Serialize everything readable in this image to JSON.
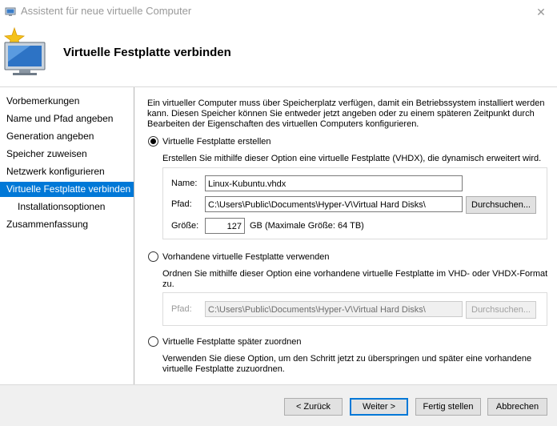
{
  "window": {
    "title": "Assistent für neue virtuelle Computer",
    "close_glyph": "✕"
  },
  "header": {
    "title": "Virtuelle Festplatte verbinden",
    "icon": "new-vm-wizard-icon"
  },
  "sidebar": {
    "items": [
      {
        "label": "Vorbemerkungen",
        "active": false,
        "sub": false
      },
      {
        "label": "Name und Pfad angeben",
        "active": false,
        "sub": false
      },
      {
        "label": "Generation angeben",
        "active": false,
        "sub": false
      },
      {
        "label": "Speicher zuweisen",
        "active": false,
        "sub": false
      },
      {
        "label": "Netzwerk konfigurieren",
        "active": false,
        "sub": false
      },
      {
        "label": "Virtuelle Festplatte verbinden",
        "active": true,
        "sub": false
      },
      {
        "label": "Installationsoptionen",
        "active": false,
        "sub": true
      },
      {
        "label": "Zusammenfassung",
        "active": false,
        "sub": false
      }
    ]
  },
  "main": {
    "intro_line1": "Ein virtueller Computer muss über Speicherplatz verfügen, damit ein Betriebssystem installiert werden",
    "intro_line2": "kann. Diesen Speicher können Sie entweder jetzt angeben oder zu einem späteren Zeitpunkt durch",
    "intro_line3": "Bearbeiten der Eigenschaften des virtuellen Computers konfigurieren.",
    "option_create": {
      "label": "Virtuelle Festplatte erstellen",
      "selected": true,
      "description": "Erstellen Sie mithilfe dieser Option eine virtuelle Festplatte (VHDX), die dynamisch erweitert wird.",
      "name_label": "Name:",
      "name_value": "Linux-Kubuntu.vhdx",
      "path_label": "Pfad:",
      "path_value": "C:\\Users\\Public\\Documents\\Hyper-V\\Virtual Hard Disks\\",
      "browse_label": "Durchsuchen...",
      "size_label": "Größe:",
      "size_value": "127",
      "size_hint": "GB (Maximale Größe: 64 TB)"
    },
    "option_existing": {
      "label": "Vorhandene virtuelle Festplatte verwenden",
      "selected": false,
      "desc_line1": "Ordnen Sie mithilfe dieser Option eine vorhandene virtuelle Festplatte im VHD- oder VHDX-Format",
      "desc_line2": "zu.",
      "path_label": "Pfad:",
      "path_value": "C:\\Users\\Public\\Documents\\Hyper-V\\Virtual Hard Disks\\",
      "browse_label": "Durchsuchen..."
    },
    "option_later": {
      "label": "Virtuelle Festplatte später zuordnen",
      "selected": false,
      "desc_line1": "Verwenden Sie diese Option, um den Schritt jetzt zu überspringen und später eine vorhandene",
      "desc_line2": "virtuelle Festplatte zuzuordnen."
    }
  },
  "footer": {
    "back_label": "< Zurück",
    "next_label": "Weiter >",
    "finish_label": "Fertig stellen",
    "cancel_label": "Abbrechen"
  },
  "colors": {
    "accent": "#0078d7",
    "footer_bg": "#f0f0f0"
  }
}
